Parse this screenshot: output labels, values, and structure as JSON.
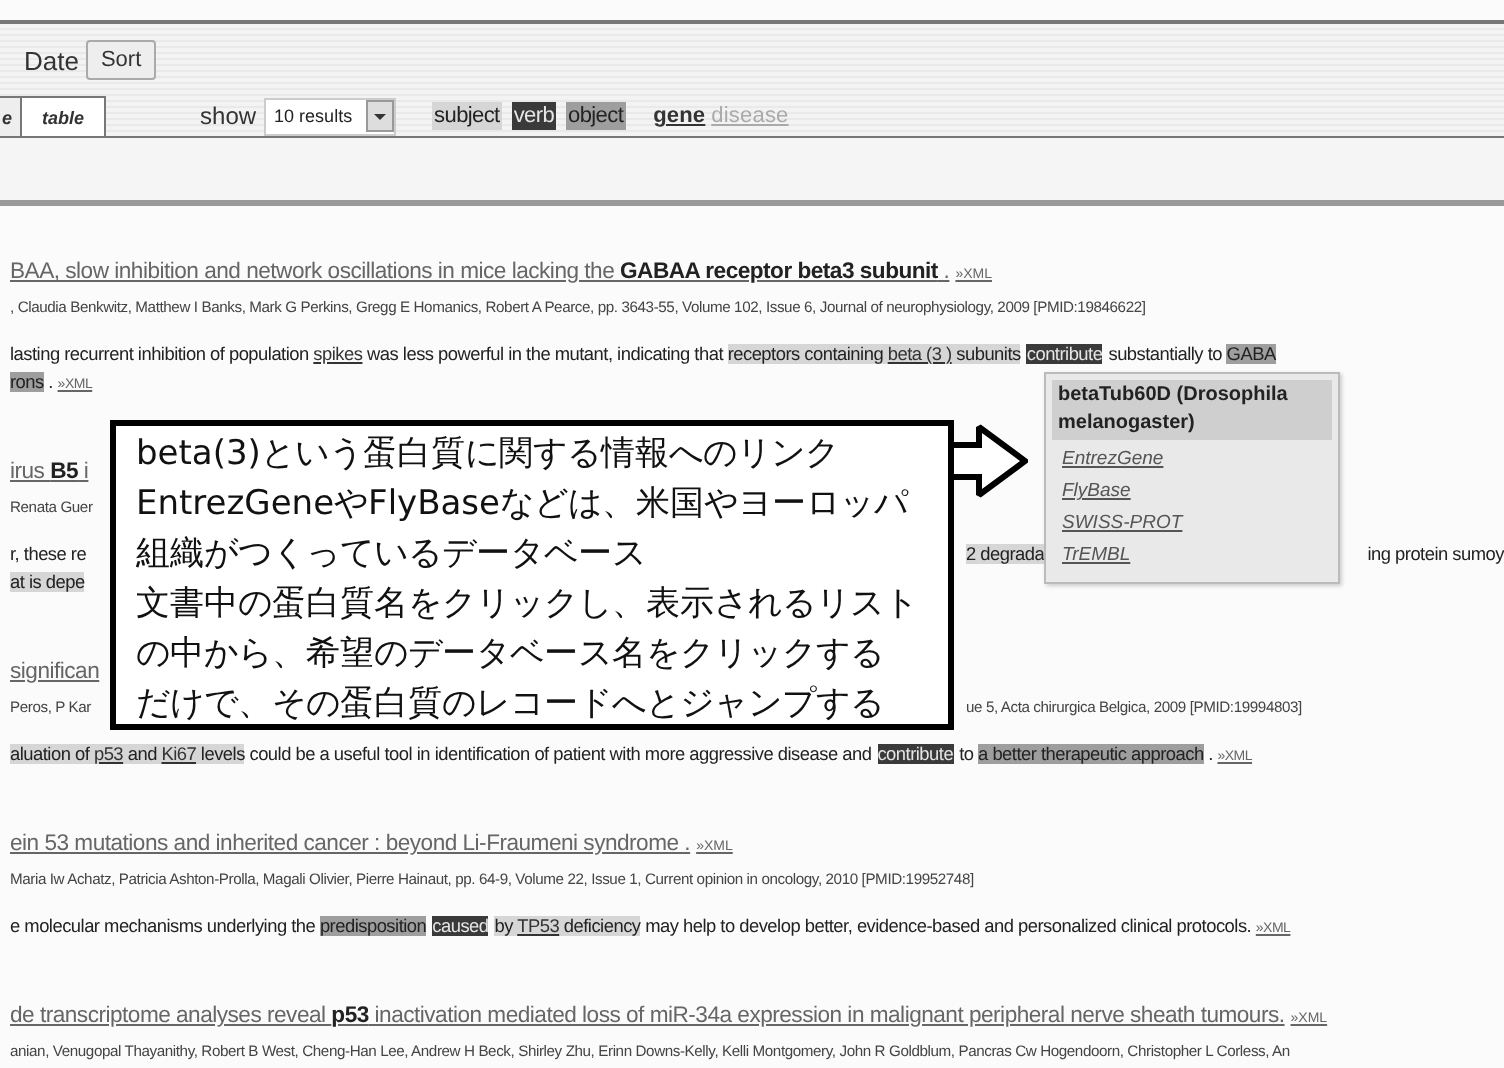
{
  "toolbar": {
    "sort_label": "Date",
    "sort_button": "Sort",
    "tabs": [
      {
        "label": "e",
        "selected": false
      },
      {
        "label": "table",
        "selected": true
      }
    ],
    "show_label": "show",
    "results_select": "10 results",
    "roles": [
      {
        "kind": "subject",
        "label": "subject"
      },
      {
        "kind": "verb",
        "label": "verb"
      },
      {
        "kind": "object",
        "label": "object"
      }
    ],
    "terms": [
      {
        "label": "gene",
        "on": true
      },
      {
        "label": "disease",
        "on": false
      }
    ]
  },
  "results": [
    {
      "title": "BAA, slow inhibition and network oscillations in mice lacking the **GABAA receptor beta3 subunit** .",
      "xml": "»XML",
      "authors": [
        ", Claudia Benkwitz, Matthew I Banks, Mark G Perkins, Gregg E Homanics, Robert A Pearce, pp. 3643-55, Volume 102, Issue 6, Journal of neurophysiology, 2009 [PMID:19846622]"
      ],
      "snippet": [
        [
          [
            {
              "text": "lasting recurrent inhibition of population ",
              "kind": "plain"
            },
            {
              "text": "spikes",
              "kind": "plain",
              "gene": true
            },
            {
              "text": " was less powerful in the mutant, indicating that ",
              "kind": "plain"
            },
            {
              "text": "receptors containing ",
              "kind": "subject"
            },
            {
              "text": "beta (3 )",
              "kind": "subject",
              "gene": true
            },
            {
              "text": " subunits",
              "kind": "subject"
            },
            {
              "text": "contribute",
              "kind": "verb"
            },
            {
              "text": "substantially to ",
              "kind": "plain"
            },
            {
              "text": "GABA",
              "kind": "object"
            }
          ]
        ],
        [
          [
            {
              "text": "rons",
              "kind": "object"
            },
            {
              "text": " . ",
              "kind": "plain"
            },
            {
              "text": "»XML",
              "kind": "xml"
            }
          ]
        ]
      ]
    },
    {
      "title": "irus **B5** i",
      "authors": [
        "Renata Guer"
      ],
      "snippet": [
        [
          [
            {
              "text": "r, these re",
              "kind": "plain"
            }
          ],
          [
            {
              "text": "2 degrada",
              "kind": "subject"
            }
          ],
          [
            {
              "text": "ing protein sumoy",
              "kind": "plain"
            }
          ]
        ],
        [
          [
            {
              "text": "at is depe",
              "kind": "subject"
            }
          ]
        ]
      ]
    },
    {
      "title": "significan",
      "authors": [
        "Peros, P Kar",
        "ue 5, Acta chirurgica Belgica, 2009 [PMID:19994803]"
      ],
      "snippet": [
        [
          [
            {
              "text": "aluation of ",
              "kind": "subject"
            },
            {
              "text": "p53",
              "kind": "subject",
              "gene": true
            },
            {
              "text": " and ",
              "kind": "subject"
            },
            {
              "text": "Ki67",
              "kind": "subject",
              "gene": true
            },
            {
              "text": " levels",
              "kind": "subject"
            },
            {
              "text": " could be a useful tool in identification of patient with more aggressive disease and",
              "kind": "plain"
            },
            {
              "text": "contribute",
              "kind": "verb"
            },
            {
              "text": "to ",
              "kind": "plain"
            },
            {
              "text": "a better therapeutic approach",
              "kind": "object"
            },
            {
              "text": " . ",
              "kind": "plain"
            },
            {
              "text": "»XML",
              "kind": "xml"
            }
          ]
        ]
      ]
    },
    {
      "title": "ein 53 mutations and inherited cancer : beyond Li-Fraumeni syndrome .",
      "xml": "»XML",
      "authors": [
        "Maria Iw Achatz, Patricia Ashton-Prolla, Magali Olivier, Pierre Hainaut, pp. 64-9, Volume 22, Issue 1, Current opinion in oncology, 2010 [PMID:19952748]"
      ],
      "snippet": [
        [
          [
            {
              "text": "e molecular mechanisms underlying the ",
              "kind": "plain"
            },
            {
              "text": "predisposition",
              "kind": "object"
            },
            {
              "text": "caused",
              "kind": "verb"
            },
            {
              "text": "by ",
              "kind": "subject"
            },
            {
              "text": "TP53",
              "kind": "subject",
              "gene": true
            },
            {
              "text": " deficiency",
              "kind": "subject"
            },
            {
              "text": " may help to develop better, evidence-based and personalized clinical protocols. ",
              "kind": "plain"
            },
            {
              "text": "»XML",
              "kind": "xml"
            }
          ]
        ]
      ]
    },
    {
      "title": "de transcriptome analyses reveal **p53** inactivation mediated loss of miR-34a expression in malignant peripheral nerve sheath tumours.",
      "xml": "»XML",
      "authors": [
        "anian, Venugopal Thayanithy, Robert B West, Cheng-Han Lee, Andrew H Beck, Shirley Zhu, Erinn Downs-Kelly, Kelli Montgomery, John R Goldblum, Pancras Cw Hogendoorn, Christopher L Corless, An"
      ]
    }
  ],
  "popup": {
    "title": "betaTub60D (Drosophila melanogaster)",
    "links": [
      "EntrezGene",
      "FlyBase",
      "SWISS-PROT",
      "TrEMBL"
    ]
  },
  "callout": {
    "lines": [
      "beta(3)という蛋白質に関する情報へのリンク",
      "EntrezGeneやFlyBaseなどは、米国やヨーロッパ",
      "組織がつくっているデータベース",
      "文書中の蛋白質名をクリックし、表示されるリスト",
      "の中から、希望のデータベース名をクリックする",
      "だけで、その蛋白質のレコードへとジャンプする"
    ]
  }
}
